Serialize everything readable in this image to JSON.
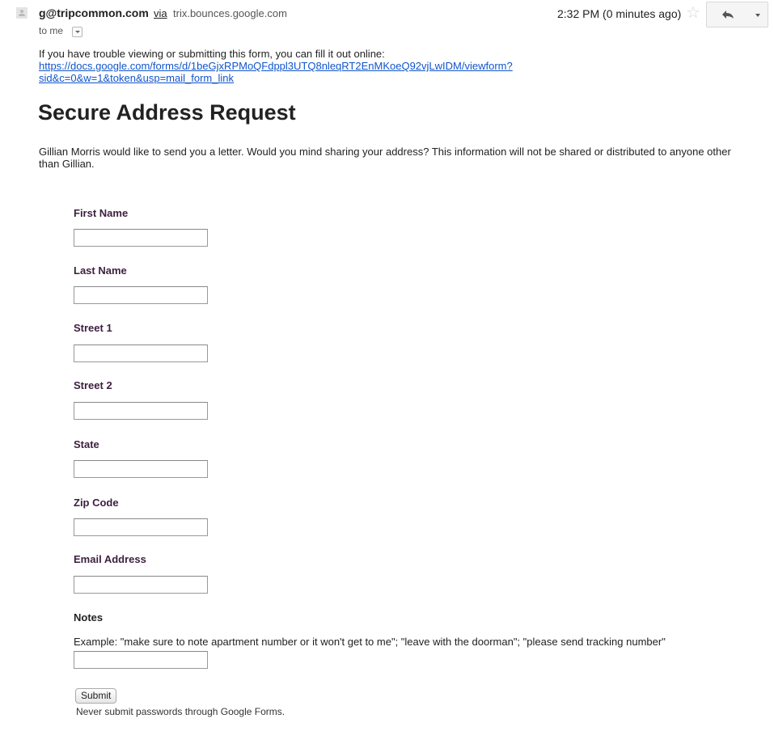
{
  "header": {
    "sender": "g@tripcommon.com",
    "via_label": "via",
    "via_domain": "trix.bounces.google.com",
    "recipient": "to me",
    "time": "2:32 PM (0 minutes ago)"
  },
  "icons": {
    "avatar": "avatar-icon",
    "star": "star-icon",
    "reply": "reply-icon",
    "more": "chevron-down-icon",
    "details": "chevron-down-icon"
  },
  "intro": {
    "trouble_text": "If you have trouble viewing or submitting this form, you can fill it out online:",
    "link_text": "https://docs.google.com/forms/d/1beGjxRPMoQFdppl3UTQ8nleqRT2EnMKoeQ92vjLwIDM/viewform?sid&c=0&w=1&token&usp=mail_form_link"
  },
  "form": {
    "title": "Secure Address Request",
    "description": "Gillian Morris would like to send you a letter. Would you mind sharing your address? This information will not be shared or distributed to anyone other than Gillian.",
    "fields": [
      {
        "label": "First Name",
        "value": ""
      },
      {
        "label": "Last Name",
        "value": ""
      },
      {
        "label": "Street 1",
        "value": ""
      },
      {
        "label": "Street 2",
        "value": ""
      },
      {
        "label": "State",
        "value": ""
      },
      {
        "label": "Zip Code",
        "value": ""
      },
      {
        "label": "Email Address",
        "value": ""
      },
      {
        "label": "Notes",
        "value": ""
      }
    ],
    "notes_help": "Example: \"make sure to note apartment number or it won't get to me\"; \"leave with the doorman\"; \"please send tracking number\"",
    "submit_label": "Submit",
    "footer_note": "Never submit passwords through Google Forms."
  },
  "colors": {
    "link": "#1155cc",
    "question_label": "#3c1f3e"
  }
}
